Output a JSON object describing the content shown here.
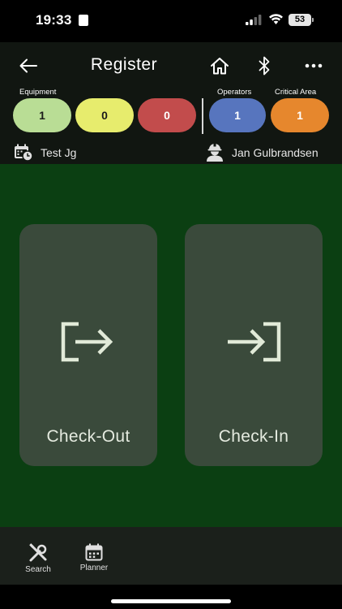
{
  "status_bar": {
    "time": "19:33",
    "battery": "53"
  },
  "header": {
    "title": "Register",
    "labels": {
      "equipment": "Equipment",
      "operators": "Operators",
      "critical_area": "Critical Area"
    },
    "counts": {
      "green": "1",
      "yellow": "0",
      "red": "0",
      "operators": "1",
      "critical_area": "1"
    },
    "project": "Test Jg",
    "operator": "Jan Gulbrandsen"
  },
  "actions": {
    "check_out": "Check-Out",
    "check_in": "Check-In"
  },
  "nav": {
    "search": "Search",
    "planner": "Planner"
  },
  "colors": {
    "header_bg": "#111611",
    "main_bg": "#0b3f12",
    "card_bg": "#3a4a3b",
    "green": "#b9dd95",
    "yellow": "#e7ec6d",
    "red": "#c24c4c",
    "blue": "#5775be",
    "orange": "#e6872d"
  },
  "icons": [
    "back-arrow-icon",
    "home-icon",
    "bluetooth-icon",
    "more-icon",
    "calendar-clock-icon",
    "worker-helmet-icon",
    "check-out-icon",
    "check-in-icon",
    "tools-icon",
    "planner-calendar-icon"
  ]
}
